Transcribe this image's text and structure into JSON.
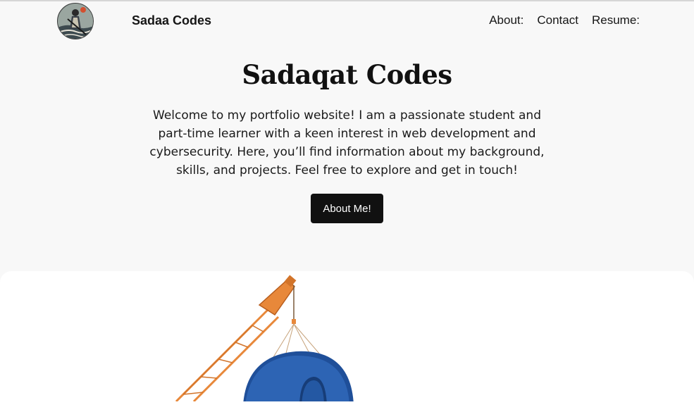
{
  "header": {
    "brand": "Sadaa Codes",
    "avatar_icon": "samurai-portrait-icon",
    "nav": [
      {
        "label": "About:"
      },
      {
        "label": "Contact"
      },
      {
        "label": "Resume:"
      }
    ]
  },
  "hero": {
    "title": "Sadaqat Codes",
    "description": "Welcome to my portfolio website! I am a passionate student and part-time learner with a keen interest in web development and cybersecurity. Here, you’ll find information about my background, skills, and projects. Feel free to explore and get in touch!",
    "button_label": "About Me!"
  },
  "illustration": {
    "icon": "crane-lifting-letter-icon",
    "colors": {
      "crane": "#e8883a",
      "letter": "#2d64b4"
    }
  },
  "colors": {
    "page_bg": "#f8f8f8",
    "button_bg": "#111111",
    "button_text": "#ffffff",
    "card_bg": "#ffffff"
  }
}
